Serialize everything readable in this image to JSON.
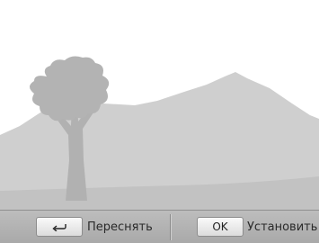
{
  "preview": {
    "scene": "illustration-tree-and-mountains"
  },
  "bottom_bar": {
    "retake": {
      "key_icon": "return-arrow-icon",
      "label": "Переснять"
    },
    "set": {
      "key_label": "OK",
      "label": "Установить"
    }
  },
  "colors": {
    "scene_gray": "#cccccc",
    "ground_gray": "#c3c3c3",
    "tree_gray": "#b3b3b3",
    "bar_gray": "#b5b5b5"
  }
}
